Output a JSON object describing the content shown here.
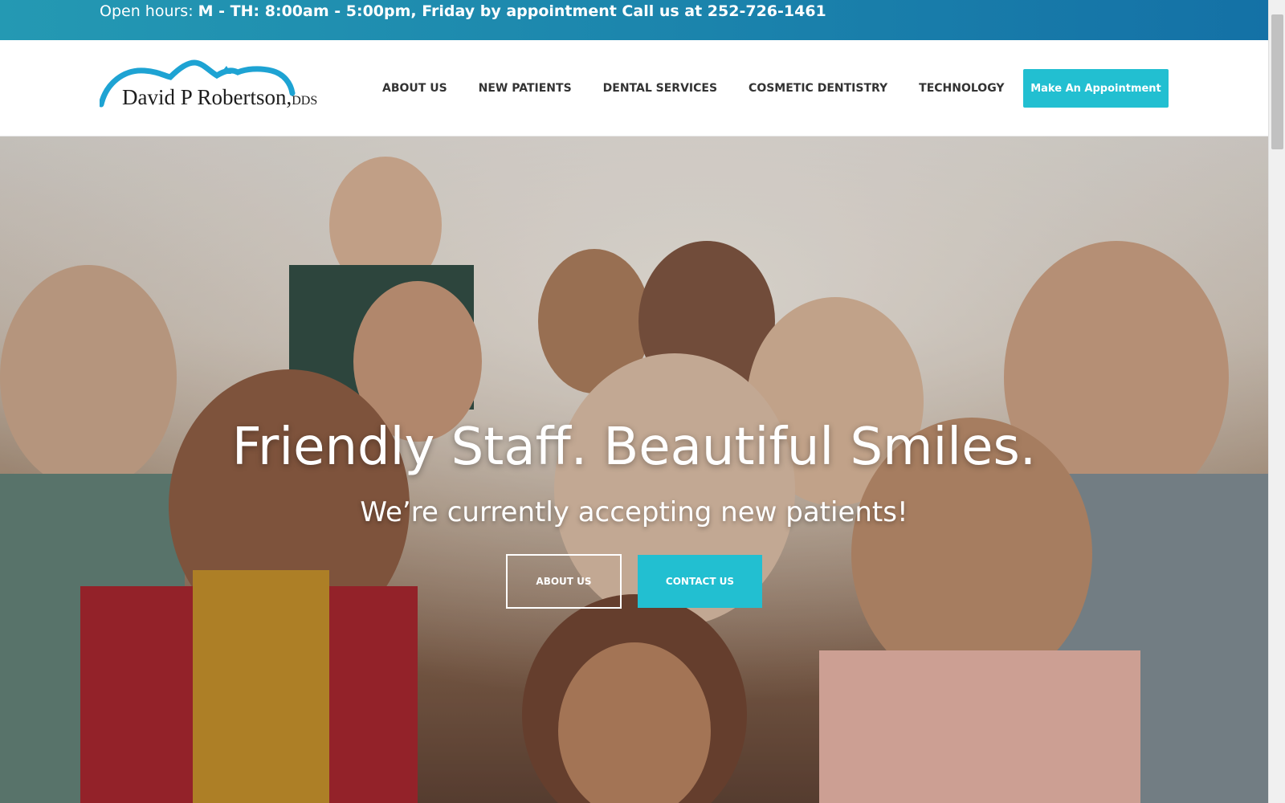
{
  "topbar": {
    "label": "Open hours:",
    "value": "M - TH: 8:00am - 5:00pm, Friday by appointment Call us at 252-726-1461"
  },
  "logo": {
    "name": "David P Robertson,",
    "suffix": "DDS"
  },
  "nav": {
    "items": [
      {
        "label": "ABOUT US"
      },
      {
        "label": "NEW PATIENTS"
      },
      {
        "label": "DENTAL SERVICES"
      },
      {
        "label": "COSMETIC DENTISTRY"
      },
      {
        "label": "TECHNOLOGY"
      }
    ],
    "cta_label": "Make An Appointment"
  },
  "hero": {
    "title": "Friendly Staff. Beautiful Smiles.",
    "subtitle": "We’re currently accepting new patients!",
    "primary_button": "ABOUT US",
    "secondary_button": "CONTACT US"
  },
  "colors": {
    "topbar_start": "#2499b3",
    "topbar_end": "#1471a6",
    "accent": "#22bfd1",
    "nav_text": "#333333",
    "logo_arc": "#1ea3d3"
  }
}
